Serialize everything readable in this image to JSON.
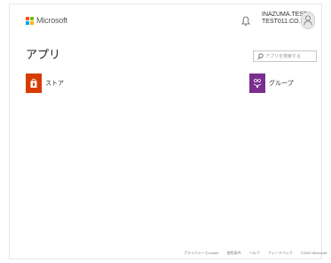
{
  "header": {
    "brand": "Microsoft",
    "user_line1": "INAZUMA.TEST",
    "user_line2": "TEST011.CO.JP"
  },
  "main": {
    "title": "アプリ",
    "search_placeholder": "アプリを検索する"
  },
  "apps": [
    {
      "label": "ストア",
      "icon": "store-bag-icon",
      "color": "#d83b01"
    },
    {
      "label": "グループ",
      "icon": "groups-icon",
      "color": "#7a2e8e"
    }
  ],
  "footer": {
    "privacy": "プライバシーとcookie",
    "terms": "使用条件",
    "help": "ヘルプ",
    "feedback": "フィードバック",
    "copyright": "©2020 Microsoft"
  },
  "colors": {
    "ms_red": "#f25022",
    "ms_green": "#7fba00",
    "ms_blue": "#00a4ef",
    "ms_yellow": "#ffb900"
  }
}
